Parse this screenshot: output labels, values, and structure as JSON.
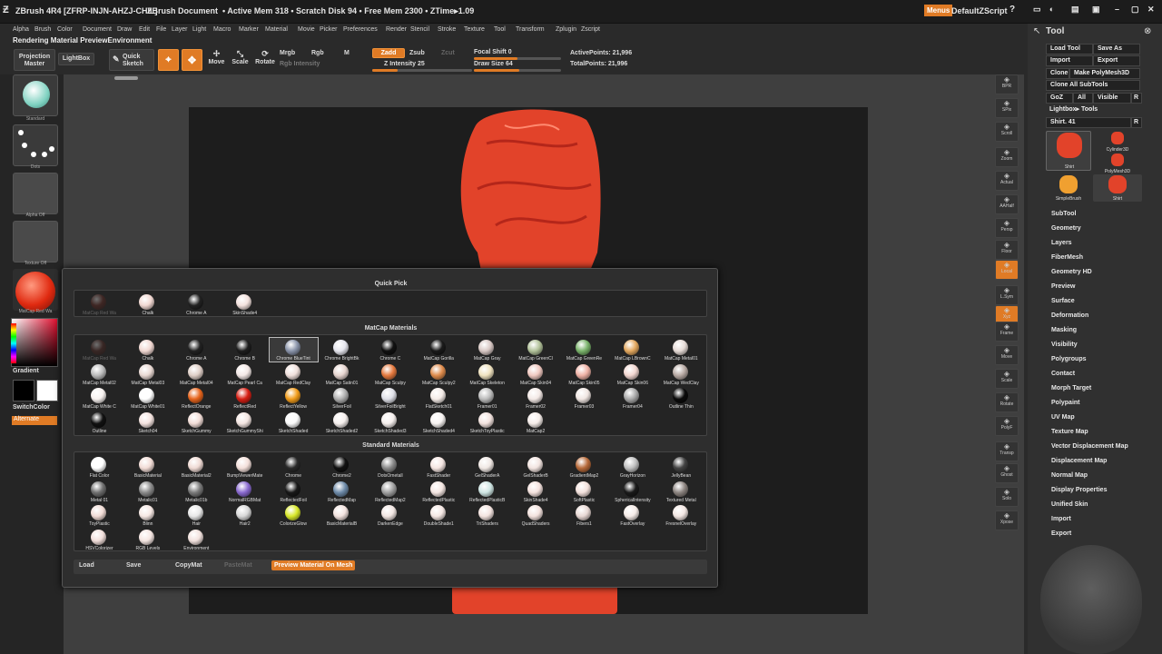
{
  "titlebar": {
    "app_name": "ZBrush 4R4 [ZFRP-INJN-AHZJ-CHIL]",
    "document": "ZBrush Document",
    "stats": "• Active Mem 318 • Scratch Disk 94 • Free Mem 2300 • ZTime▸1.09",
    "menus_btn": "Menus",
    "script": "DefaultZScript"
  },
  "menubar": [
    "Alpha",
    "Brush",
    "Color",
    "Document",
    "Draw",
    "Edit",
    "File",
    "Layer",
    "Light",
    "Macro",
    "Marker",
    "Material",
    "Movie",
    "Picker",
    "Preferences",
    "Render",
    "Stencil",
    "Stroke",
    "Texture",
    "Tool",
    "Transform",
    "Zplugin",
    "Zscript"
  ],
  "status_line": "Rendering Material PreviewEnvironment",
  "toolbar": {
    "projection_master": "Projection Master",
    "lightbox": "LightBox",
    "quick_sketch": "Quick Sketch",
    "edit": "Edit",
    "draw": "Draw",
    "move": "Move",
    "scale": "Scale",
    "rotate": "Rotate",
    "mrgb": "Mrgb",
    "rgb": "Rgb",
    "m": "M",
    "rgb_intensity": "Rgb Intensity",
    "zadd": "Zadd",
    "zsub": "Zsub",
    "zcut": "Zcut",
    "z_intensity": "Z Intensity 25",
    "z_intensity_level": 0.25,
    "focal_shift": "Focal Shift 0",
    "draw_size": "Draw Size 64",
    "active_points": "ActivePoints: 21,996",
    "total_points": "TotalPoints: 21,996"
  },
  "left_tray": {
    "standard": "Standard",
    "dots": "Dots",
    "alpha_off": "Alpha Off",
    "texture_off": "Texture Off",
    "material": "MatCap Red Wa",
    "gradient": "Gradient",
    "switch_color": "SwitchColor",
    "alternate": "Alternate"
  },
  "right_shelf": [
    "BPR",
    "SPix",
    "Scroll",
    "Zoom",
    "Actual",
    "AAHalf",
    "Persp",
    "Floor",
    "Local",
    "L.Sym",
    "Xyz",
    "Frame",
    "Move",
    "Scale",
    "Rotate",
    "PolyF",
    "Transp",
    "Ghost",
    "Solo",
    "Xpose"
  ],
  "tool_panel": {
    "title": "Tool",
    "load_tool": "Load Tool",
    "save_as": "Save As",
    "import": "Import",
    "export": "Export",
    "clone": "Clone",
    "make_polymesh": "Make PolyMesh3D",
    "clone_all": "Clone All SubTools",
    "goz": "GoZ",
    "all": "All",
    "visible": "Visible",
    "r": "R",
    "lightbox_tools": "Lightbox▸ Tools",
    "shirt_slider": "Shirt. 41",
    "tools": [
      {
        "name": "Shirt",
        "color": "#e2432a"
      },
      {
        "name": "Cylinder3D",
        "color": "#e2432a"
      },
      {
        "name": "PolyMesh3D",
        "color": "#e2432a"
      },
      {
        "name": "SimpleBrush",
        "color": "#f0a030"
      },
      {
        "name": "Shirt",
        "color": "#e2432a"
      }
    ],
    "sections": [
      "SubTool",
      "Geometry",
      "Layers",
      "FiberMesh",
      "Geometry HD",
      "Preview",
      "Surface",
      "Deformation",
      "Masking",
      "Visibility",
      "Polygroups",
      "Contact",
      "Morph Target",
      "Polypaint",
      "UV Map",
      "Texture Map",
      "Vector Displacement Map",
      "Displacement Map",
      "Normal Map",
      "Display Properties",
      "Unified Skin",
      "Import",
      "Export"
    ]
  },
  "material_popup": {
    "quick_pick_title": "Quick Pick",
    "matcap_title": "MatCap Materials",
    "standard_title": "Standard Materials",
    "quick_pick": [
      {
        "name": "MatCap Red Wa",
        "color": "#6e2a22"
      },
      {
        "name": "Chalk",
        "color": "#f1d8d2"
      },
      {
        "name": "Chrome A",
        "color": "#222"
      },
      {
        "name": "SkinShade4",
        "color": "#f4e2de"
      }
    ],
    "matcap": [
      {
        "name": "MatCap Red Wa",
        "color": "#5d2b24"
      },
      {
        "name": "Chalk",
        "color": "#f1d8d2"
      },
      {
        "name": "Chrome A",
        "color": "#222"
      },
      {
        "name": "Chrome B",
        "color": "#1e1e1e"
      },
      {
        "name": "Chrome BlueTint",
        "color": "#8a94aa"
      },
      {
        "name": "Chrome BrightBk",
        "color": "#e6e6ee"
      },
      {
        "name": "Chrome C",
        "color": "#111"
      },
      {
        "name": "MatCap Gorilla",
        "color": "#1a1a1a"
      },
      {
        "name": "MatCap Gray",
        "color": "#d8c8c4"
      },
      {
        "name": "MatCap GreenCl",
        "color": "#b2c29a"
      },
      {
        "name": "MatCap GreenRe",
        "color": "#7ab36b"
      },
      {
        "name": "MatCap LBrownC",
        "color": "#e3a85f"
      },
      {
        "name": "MatCap Metal01",
        "color": "#e6dbd6"
      },
      {
        "name": "MatCap Metal02",
        "color": "#bbb"
      },
      {
        "name": "MatCap Metal03",
        "color": "#e9d9d3"
      },
      {
        "name": "MatCap Metal04",
        "color": "#e0d0c8"
      },
      {
        "name": "MatCap Pearl Ca",
        "color": "#f3e8e6"
      },
      {
        "name": "MatCap RedClay",
        "color": "#f0e0dc"
      },
      {
        "name": "MatCap Satin01",
        "color": "#e7d5d0"
      },
      {
        "name": "MatCap Sculpy",
        "color": "#e67a3f"
      },
      {
        "name": "MatCap Sculpy2",
        "color": "#e08c4c"
      },
      {
        "name": "MatCap Skeleton",
        "color": "#f0e3c0"
      },
      {
        "name": "MatCap Skin04",
        "color": "#f1c9c1"
      },
      {
        "name": "MatCap Skin05",
        "color": "#efb2a6"
      },
      {
        "name": "MatCap Skin06",
        "color": "#f2d6d0"
      },
      {
        "name": "MatCap WedClay",
        "color": "#b8aaa4"
      },
      {
        "name": "MatCap White C",
        "color": "#f8f2f0"
      },
      {
        "name": "MatCap White01",
        "color": "#ffffff"
      },
      {
        "name": "ReflectOrange",
        "color": "#e7651d"
      },
      {
        "name": "ReflectRed",
        "color": "#d82015"
      },
      {
        "name": "ReflectYellow",
        "color": "#f29d1c"
      },
      {
        "name": "SilverFoil",
        "color": "#b0b0b0"
      },
      {
        "name": "SilverFoilBright",
        "color": "#dfe0e8"
      },
      {
        "name": "FlatSketch01",
        "color": "#f5ece8"
      },
      {
        "name": "Framer01",
        "color": "#bcbcbc"
      },
      {
        "name": "Framer02",
        "color": "#f3e9e6"
      },
      {
        "name": "Framer03",
        "color": "#f0e6e2"
      },
      {
        "name": "Framer04",
        "color": "#a9a9a9"
      },
      {
        "name": "Outline Thin",
        "color": "#0b0b0b"
      },
      {
        "name": "Outline",
        "color": "#111"
      },
      {
        "name": "Sketch04",
        "color": "#f4e3df"
      },
      {
        "name": "SketchGummy",
        "color": "#f2ddd7"
      },
      {
        "name": "SketchGummyShi",
        "color": "#f4e6e2"
      },
      {
        "name": "SketchShaded",
        "color": "#fafafa"
      },
      {
        "name": "SketchShaded2",
        "color": "#f6f0ee"
      },
      {
        "name": "SketchShaded3",
        "color": "#f5efed"
      },
      {
        "name": "SketchShaded4",
        "color": "#f8f4f2"
      },
      {
        "name": "SketchToyPlastic",
        "color": "#f2e2de"
      },
      {
        "name": "MatCap2",
        "color": "#f5ede9"
      }
    ],
    "standard": [
      {
        "name": "Flat Color",
        "color": "#ffffff"
      },
      {
        "name": "BasicMaterial",
        "color": "#f2dcd6"
      },
      {
        "name": "BasicMaterial2",
        "color": "#efdad4"
      },
      {
        "name": "BumpViewerMate",
        "color": "#f3dfda"
      },
      {
        "name": "Chrome",
        "color": "#2a2a2a"
      },
      {
        "name": "Chrome2",
        "color": "#111"
      },
      {
        "name": "DotsOmetall",
        "color": "#8a8a8a"
      },
      {
        "name": "FastShader",
        "color": "#f5e6e2"
      },
      {
        "name": "GelShaderA",
        "color": "#f0e8e4"
      },
      {
        "name": "GelShaderB",
        "color": "#f2e4e0"
      },
      {
        "name": "GradientMap2",
        "color": "#b76a3a"
      },
      {
        "name": "GrayHorizon",
        "color": "#bfbfbf"
      },
      {
        "name": "JellyBean",
        "color": "#444"
      },
      {
        "name": "Metal 01",
        "color": "#707070"
      },
      {
        "name": "Metalic01",
        "color": "#8a8a8a"
      },
      {
        "name": "Metalic01b",
        "color": "#7a7a7a"
      },
      {
        "name": "NormalRGBMat",
        "color": "#8a6ad0"
      },
      {
        "name": "ReflectedFoil",
        "color": "#181818"
      },
      {
        "name": "ReflectedMap",
        "color": "#6d8aa8"
      },
      {
        "name": "ReflectedMap2",
        "color": "#a0a0a0"
      },
      {
        "name": "ReflectedPlastic",
        "color": "#f4e6e2"
      },
      {
        "name": "ReflectedPlasticB",
        "color": "#cfe6e4"
      },
      {
        "name": "SkinShade4",
        "color": "#f4e2de"
      },
      {
        "name": "SoftPlastic",
        "color": "#f3e1dc"
      },
      {
        "name": "SphericalIntensity",
        "color": "#1a1a1a"
      },
      {
        "name": "Textured Metal",
        "color": "#8c8480"
      },
      {
        "name": "ToyPlastic",
        "color": "#f2dcd6"
      },
      {
        "name": "Blinn",
        "color": "#f6e8e4"
      },
      {
        "name": "Hair",
        "color": "#e8e8e8"
      },
      {
        "name": "Hair2",
        "color": "#d8d8d8"
      },
      {
        "name": "ColorizeGlow",
        "color": "#d8e82a"
      },
      {
        "name": "BasicMaterialB",
        "color": "#f3e3df"
      },
      {
        "name": "DarkenEdge",
        "color": "#f2e6e2"
      },
      {
        "name": "DoubleShade1",
        "color": "#f5e8e4"
      },
      {
        "name": "TriShaders",
        "color": "#f4e4e0"
      },
      {
        "name": "QuadShaders",
        "color": "#f3e2de"
      },
      {
        "name": "Fibers1",
        "color": "#e8d8d4"
      },
      {
        "name": "FastOverlay",
        "color": "#f6ece8"
      },
      {
        "name": "FresnelOverlay",
        "color": "#f3e7e3"
      },
      {
        "name": "HSVColorizer",
        "color": "#f2dfdb"
      },
      {
        "name": "RGB Levels",
        "color": "#f5e6e2"
      },
      {
        "name": "Environment",
        "color": "#f2e2de"
      }
    ],
    "footer": {
      "load": "Load",
      "save": "Save",
      "copymat": "CopyMat",
      "pastemat": "PasteMat",
      "preview": "Preview Material On Mesh"
    }
  },
  "colors": {
    "accent": "#e07b25",
    "mesh_red": "#e2432a"
  }
}
